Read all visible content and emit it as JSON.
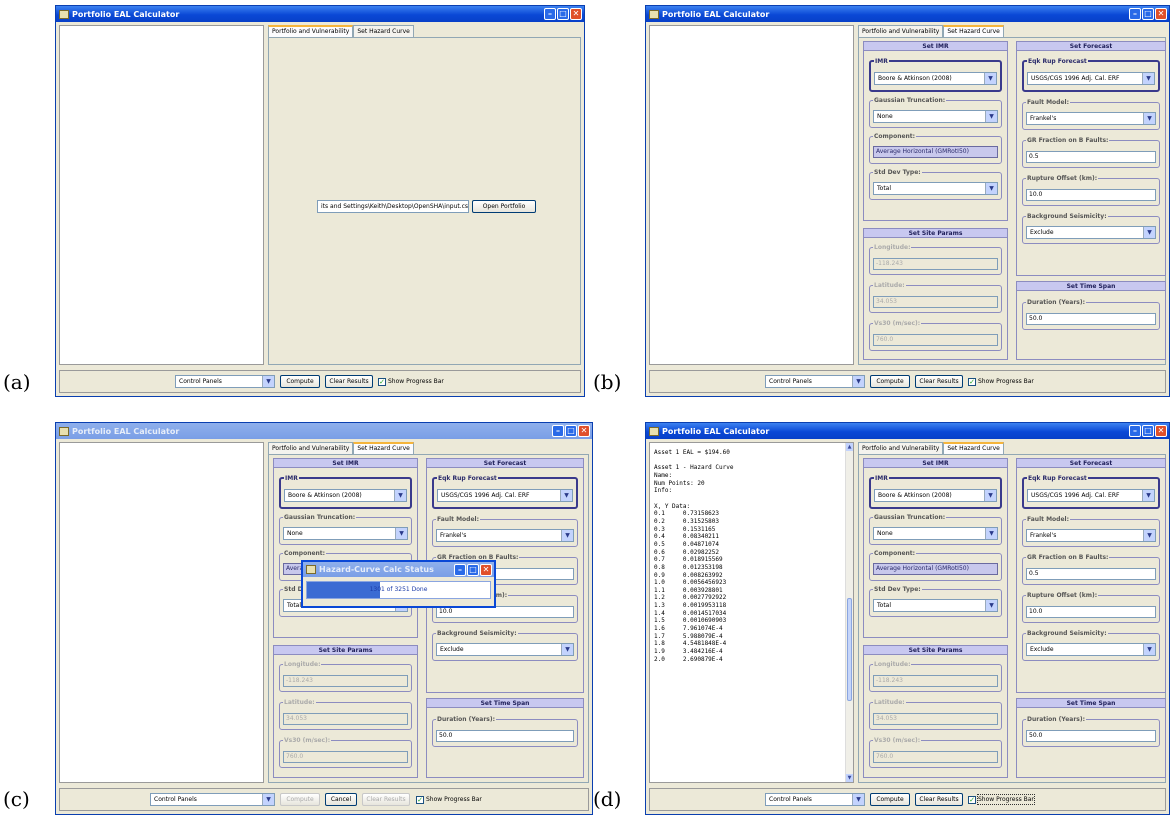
{
  "labels": {
    "a": "(a)",
    "b": "(b)",
    "c": "(c)",
    "d": "(d)"
  },
  "window": {
    "title": "Portfolio EAL Calculator"
  },
  "tabs": {
    "portfolio": "Portfolio and Vulnerability",
    "hazard": "Set Hazard Curve"
  },
  "portfolio": {
    "path": "its and Settings\\Keith\\Desktop\\OpenSHA\\input.csv",
    "open_button": "Open Portfolio"
  },
  "bottom": {
    "control_panels": "Control Panels",
    "compute": "Compute",
    "cancel": "Cancel",
    "clear_results": "Clear Results",
    "show_progress": "Show Progress Bar"
  },
  "imr": {
    "title": "Set IMR",
    "imr_label": "IMR",
    "imr_value": "Boore & Atkinson (2008)",
    "gauss_label": "Gaussian Truncation:",
    "gauss_value": "None",
    "component_label": "Component:",
    "component_value": "Average Horizontal (GMRotI50)",
    "stddev_label": "Std Dev Type:",
    "stddev_value": "Total"
  },
  "site": {
    "title": "Set Site Params",
    "lon_label": "Longitude:",
    "lon_value": "-118.243",
    "lat_label": "Latitude:",
    "lat_value": "34.053",
    "vs30_label": "Vs30 (m/sec):",
    "vs30_value": "760.0"
  },
  "forecast": {
    "title": "Set Forecast",
    "erf_label": "Eqk Rup Forecast",
    "erf_value": "USGS/CGS 1996 Adj. Cal. ERF",
    "fault_label": "Fault Model:",
    "fault_value": "Frankel's",
    "gr_label": "GR Fraction on B Faults:",
    "gr_value": "0.5",
    "offset_label": "Rupture Offset (km):",
    "offset_value": "10.0",
    "bg_label": "Background Seismicity:",
    "bg_value": "Exclude"
  },
  "timespan": {
    "title": "Set Time Span",
    "duration_label": "Duration (Years):",
    "duration_value": "50.0"
  },
  "dialog": {
    "title": "Hazard-Curve Calc Status",
    "progress_text": "1301 of 3251 Done",
    "progress": 0.4
  },
  "results": {
    "lines": [
      "Asset 1 EAL = $194.60",
      "",
      "Asset 1 - Hazard Curve",
      "Name:",
      "Num Points: 20",
      "Info:",
      "",
      "X, Y Data:",
      "0.1     0.73158623",
      "0.2     0.31525803",
      "0.3     0.1531165",
      "0.4     0.08340211",
      "0.5     0.04871074",
      "0.6     0.02982252",
      "0.7     0.018915569",
      "0.8     0.012353198",
      "0.9     0.008263992",
      "1.0     0.0056456923",
      "1.1     0.003928801",
      "1.2     0.0027792922",
      "1.3     0.0019953118",
      "1.4     0.0014517034",
      "1.5     0.0010690903",
      "1.6     7.961074E-4",
      "1.7     5.988079E-4",
      "1.8     4.5481848E-4",
      "1.9     3.484216E-4",
      "2.0     2.690879E-4"
    ]
  }
}
